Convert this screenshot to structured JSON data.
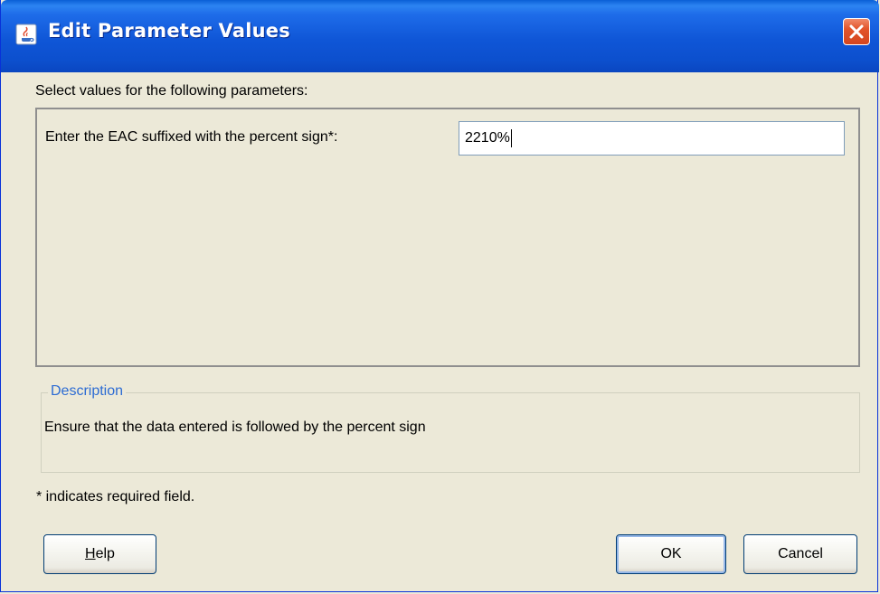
{
  "window": {
    "title": "Edit Parameter Values"
  },
  "icons": {
    "title": "java-app-icon",
    "close": "close-icon"
  },
  "colors": {
    "titlebar": "#0c4fcd",
    "close_button": "#d4461f",
    "dialog_background": "#ece9d8",
    "group_legend": "#2d6cd3"
  },
  "dialog": {
    "instruction": "Select values for the following parameters:",
    "parameters": [
      {
        "label": "Enter the EAC suffixed with the percent sign*:",
        "value": "2210%"
      }
    ],
    "description": {
      "legend": "Description",
      "text": "Ensure that the data entered is followed by the percent sign"
    },
    "required_note": "* indicates required field."
  },
  "buttons": {
    "help": {
      "mnemonic": "H",
      "rest": "elp"
    },
    "ok": "OK",
    "cancel": "Cancel"
  }
}
